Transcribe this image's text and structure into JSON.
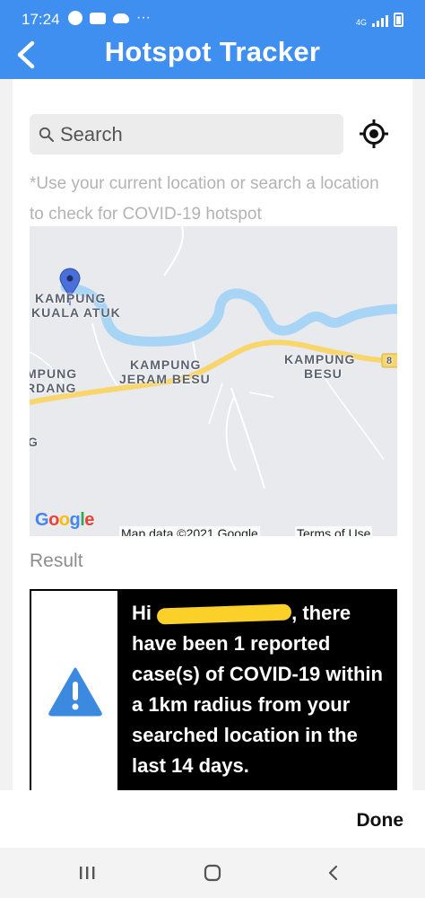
{
  "status_bar": {
    "time": "17:24",
    "network": "4G",
    "icons": [
      "app-icon",
      "chat-icon",
      "cloud-icon",
      "more-dots-icon",
      "signal-icon",
      "battery-icon"
    ]
  },
  "app_bar": {
    "title": "Hotspot Tracker",
    "back_icon": "chevron-left-icon"
  },
  "search": {
    "placeholder": "Search",
    "value": "",
    "locate_icon": "crosshair-location-icon"
  },
  "hint": "*Use your current location or search a location to check for COVID-19 hotspot",
  "map": {
    "labels": {
      "kampung_kuala_atuk": [
        "KAMPUNG",
        "KUALA ATUK"
      ],
      "kampung_jeram_besu": [
        "KAMPUNG",
        "JERAM BESU"
      ],
      "kampung_besu": [
        "KAMPUNG",
        "BESU"
      ],
      "left_partial": [
        "MPUNG",
        "RDANG"
      ],
      "left_g": "G",
      "road_number": "8"
    },
    "google_logo": "Google",
    "attribution": "Map data ©2021 Google",
    "terms": "Terms of Use",
    "colors": {
      "river": "#a8d5f5",
      "road": "#f8d66b",
      "land": "#e8eaed",
      "pin": "#4a6fd8"
    }
  },
  "result": {
    "label": "Result",
    "text_prefix": "Hi",
    "text_after": ", there have been 1 reported case(s) of COVID-19 within a 1km radius from your searched location in the last 14 days.",
    "icon": "warning-triangle-icon",
    "icon_color": "#3c89e0"
  },
  "footer": {
    "done_label": "Done"
  },
  "nav_bar": {
    "recents_icon": "recents-icon",
    "home_icon": "home-icon",
    "back_icon": "back-icon"
  },
  "colors": {
    "accent": "#3f8ff0",
    "result_bg": "#000000"
  }
}
